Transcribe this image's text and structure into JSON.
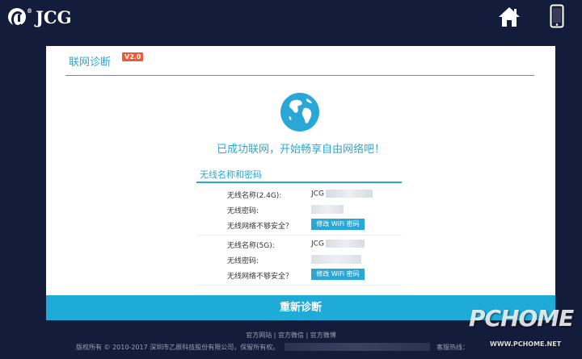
{
  "header": {
    "logo_text": "JCG",
    "home_icon": "home-icon",
    "phone_icon": "mobile-phone-icon"
  },
  "card": {
    "title": "联网诊断",
    "version": "V2.0",
    "success_message": "已成功联网，开始畅享自由网络吧！",
    "section_title": "无线名称和密码",
    "wifi_24g": {
      "name_label": "无线名称(2.4G):",
      "name_value": "JCG",
      "password_label": "无线密码:",
      "insecure_label": "无线网络不够安全？",
      "button_label": "修改 WiFi 密码"
    },
    "wifi_5g": {
      "name_label": "无线名称(5G):",
      "name_value": "JCG",
      "password_label": "无线密码:",
      "insecure_label": "无线网络不够安全？",
      "button_label": "修改 WiFi 密码"
    },
    "rediagnose_button": "重新诊断"
  },
  "footer": {
    "links": [
      "官方网站",
      "官方微信",
      "官方微博"
    ],
    "separator": "|",
    "copyright": "版权所有 © 2010-2017  深圳市乙辰科技股份有限公司，保留所有权。",
    "hotline_label": "客服热线："
  },
  "watermark": {
    "main": "PCHOME",
    "sub": "WWW.PCHOME.NET"
  },
  "colors": {
    "background": "#141c3b",
    "accent": "#29a8d8",
    "badge": "#ef5a31",
    "button": "#1eabd8"
  }
}
